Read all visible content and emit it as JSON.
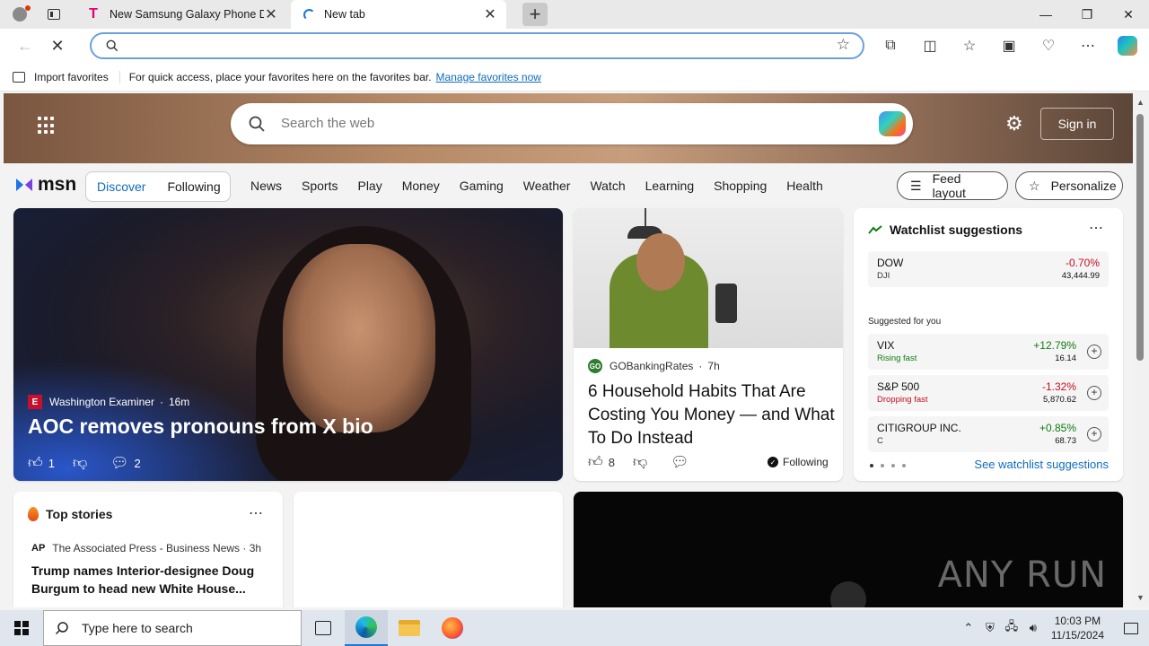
{
  "browser": {
    "tabs": [
      {
        "title": "New Samsung Galaxy Phone Dea",
        "favicon": "t-mobile-icon"
      },
      {
        "title": "New tab",
        "favicon": "loading-icon"
      }
    ],
    "favorites_bar": {
      "import_label": "Import favorites",
      "message": "For quick access, place your favorites here on the favorites bar.",
      "manage_link": "Manage favorites now"
    }
  },
  "msn": {
    "search_placeholder": "Search the web",
    "sign_in": "Sign in",
    "logo_text": "msn",
    "pills": {
      "discover": "Discover",
      "following": "Following"
    },
    "nav": [
      "News",
      "Sports",
      "Play",
      "Money",
      "Gaming",
      "Weather",
      "Watch",
      "Learning",
      "Shopping",
      "Health"
    ],
    "feed_layout": "Feed layout",
    "personalize": "Personalize",
    "hero": {
      "source": "Washington Examiner",
      "age": "16m",
      "headline": "AOC removes pronouns from X bio",
      "likes": "1",
      "comments": "2"
    },
    "story2": {
      "source": "GOBankingRates",
      "age": "7h",
      "headline": "6 Household Habits That Are Costing You Money — and What To Do Instead",
      "likes": "8",
      "following": "Following"
    },
    "watchlist": {
      "title": "Watchlist suggestions",
      "primary": {
        "name": "DOW",
        "symbol": "DJI",
        "change": "-0.70%",
        "value": "43,444.99"
      },
      "suggested_label": "Suggested for you",
      "suggestions": [
        {
          "name": "VIX",
          "status": "Rising fast",
          "change": "+12.79%",
          "value": "16.14",
          "dir": "up"
        },
        {
          "name": "S&P 500",
          "status": "Dropping fast",
          "change": "-1.32%",
          "value": "5,870.62",
          "dir": "down"
        },
        {
          "name": "CITIGROUP INC.",
          "status": "C",
          "change": "+0.85%",
          "value": "68.73",
          "dir": "up"
        }
      ],
      "see_all": "See watchlist suggestions"
    },
    "top_stories": {
      "title": "Top stories",
      "source": "The Associated Press - Business News · 3h",
      "source_logo": "AP",
      "headline": "Trump names Interior-designee Doug Burgum to head new White House..."
    },
    "video_watermark": "ANY RUN"
  },
  "taskbar": {
    "search_placeholder": "Type here to search",
    "time": "10:03 PM",
    "date": "11/15/2024"
  }
}
